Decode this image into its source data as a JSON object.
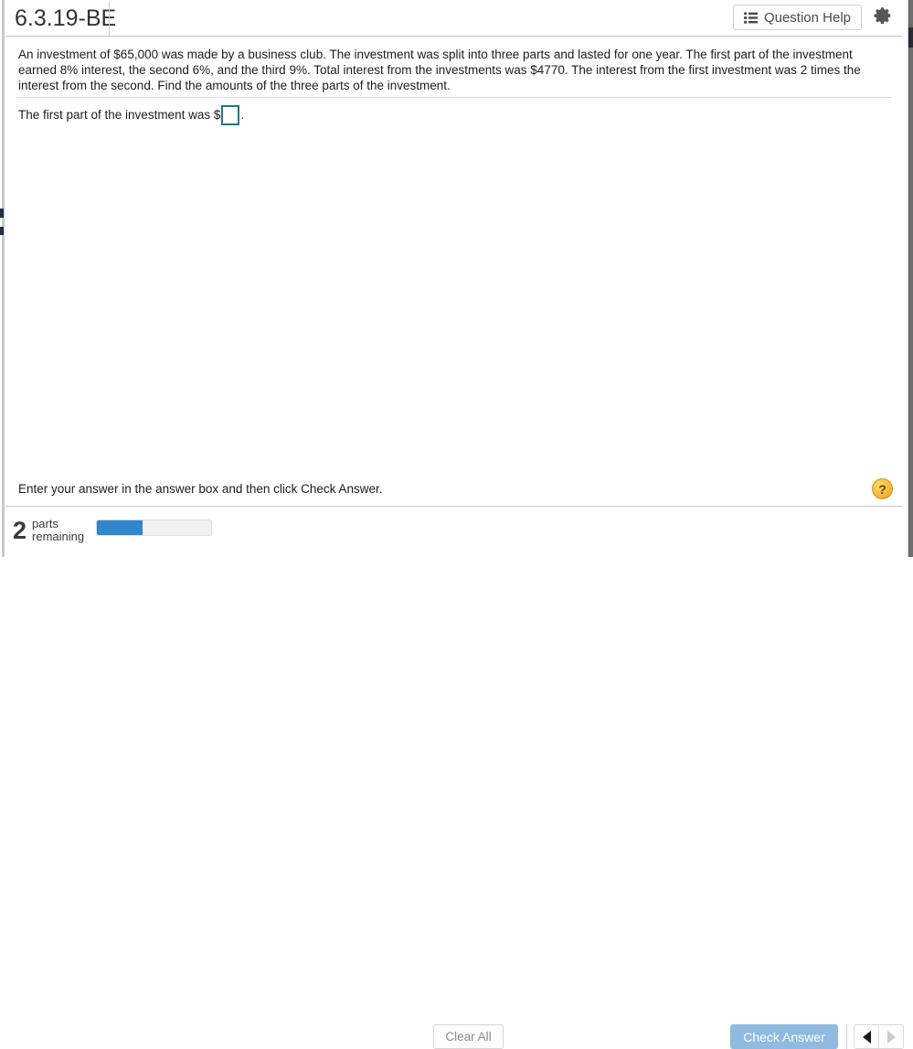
{
  "header": {
    "exercise_id": "6.3.19-BE",
    "question_help_label": "Question Help",
    "list_icon": "bulleted-list-icon",
    "gear_icon": "gear-icon"
  },
  "problem": {
    "statement": "An investment of $65,000 was made by a business club. The investment was split into three parts and lasted for one year. The first part of the investment earned 8% interest, the second 6%, and the third 9%. Total interest from the investments was $4770. The interest from the first investment was 2 times the interest from the second. Find the amounts of the three parts of the investment.",
    "answer_prompt_prefix": "The first part of the investment was $",
    "answer_prompt_suffix": ".",
    "answer_value": "",
    "answer_placeholder": "",
    "answer_box_border_color": "#1f7a8c"
  },
  "hint": {
    "text": "Enter your answer in the answer box and then click Check Answer.",
    "help_icon_label": "?"
  },
  "footer": {
    "parts_count": "2",
    "parts_label": "parts remaining",
    "progress_percent": 40,
    "clear_all_label": "Clear All",
    "check_answer_label": "Check Answer",
    "previous_label": "◀",
    "next_label": "▶",
    "check_answer_color": "#90bbe0",
    "progress_fill_color": "#3186cd"
  }
}
